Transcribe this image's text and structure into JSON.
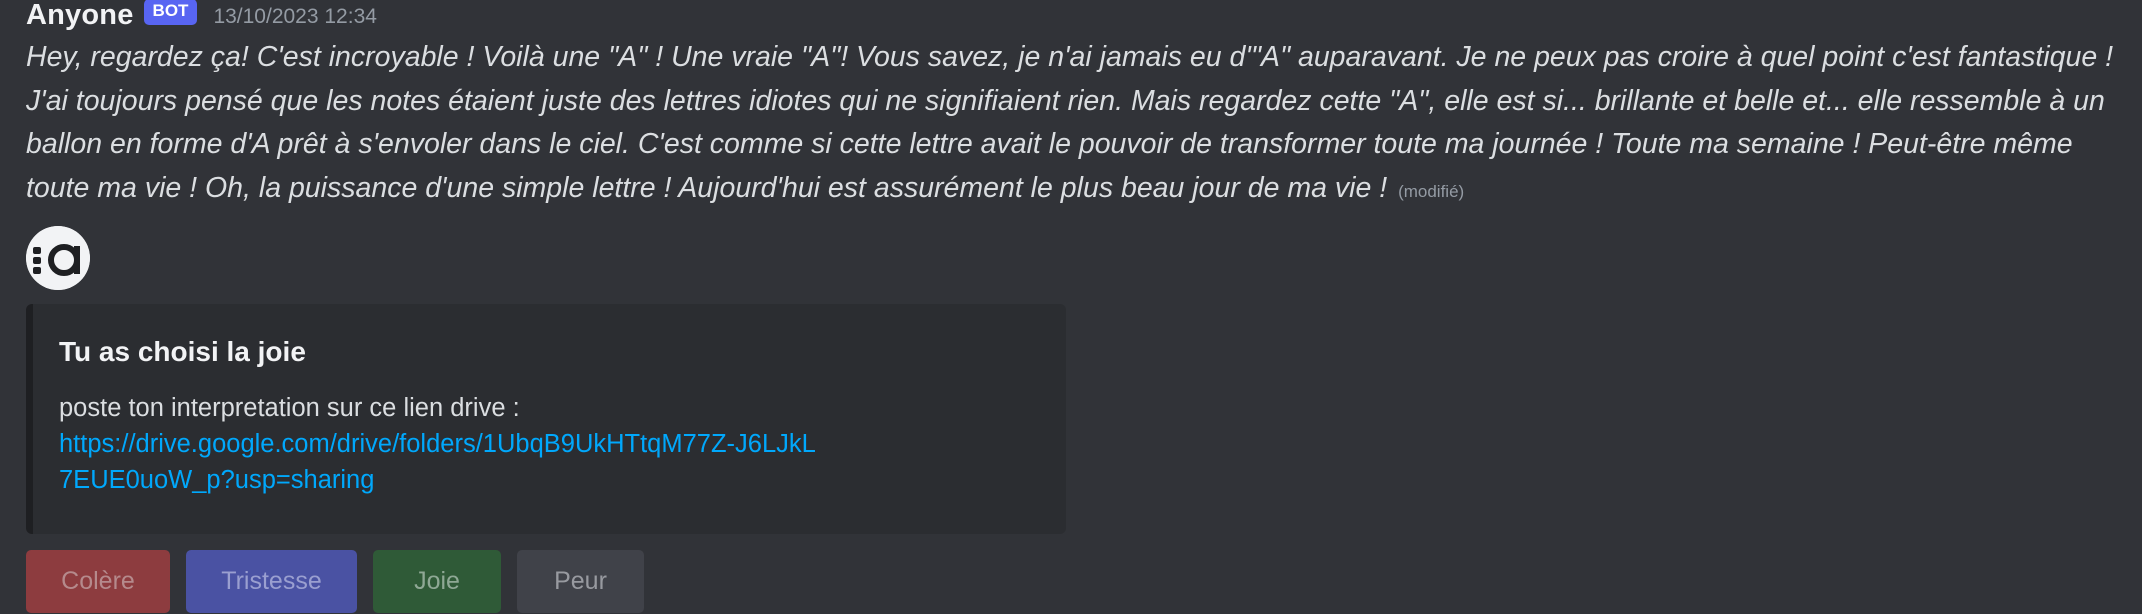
{
  "message": {
    "username": "Anyone",
    "badge": "BOT",
    "timestamp": "13/10/2023 12:34",
    "text": "Hey, regardez ça! C'est incroyable ! Voilà une \"A\" ! Une vraie \"A\"! Vous savez, je n'ai jamais eu d'\"A\" auparavant. Je ne peux pas croire à quel point c'est fantastique ! J'ai toujours pensé que les notes étaient juste des lettres idiotes qui ne signifiaient rien. Mais regardez cette \"A\", elle est si... brillante et belle et... elle ressemble à un ballon en forme d'A prêt à s'envoler dans le ciel. C'est comme si cette lettre avait le pouvoir de transformer toute ma journée ! Toute ma semaine ! Peut-être même toute ma vie ! Oh, la puissance d'une simple lettre ! Aujourd'hui est assurément le plus beau jour de ma vie !",
    "edited_label": "(modifié)",
    "attachment_icon": "a-logo-icon"
  },
  "embed": {
    "title": "Tu as choisi la joie",
    "description": "poste ton interpretation sur ce lien drive :",
    "link": "https://drive.google.com/drive/folders/1UbqB9UkHTtqM77Z-J6LJkL7EUE0uoW_p?usp=sharing"
  },
  "buttons": {
    "anger": "Colère",
    "sadness": "Tristesse",
    "joy": "Joie",
    "fear": "Peur"
  },
  "colors": {
    "background": "#313338",
    "badge": "#5865f2",
    "link": "#00a8fc",
    "anger_button": "#8d3c3f",
    "sadness_button": "#4a52a3",
    "joy_button": "#2f5a37",
    "fear_button": "#404249"
  }
}
